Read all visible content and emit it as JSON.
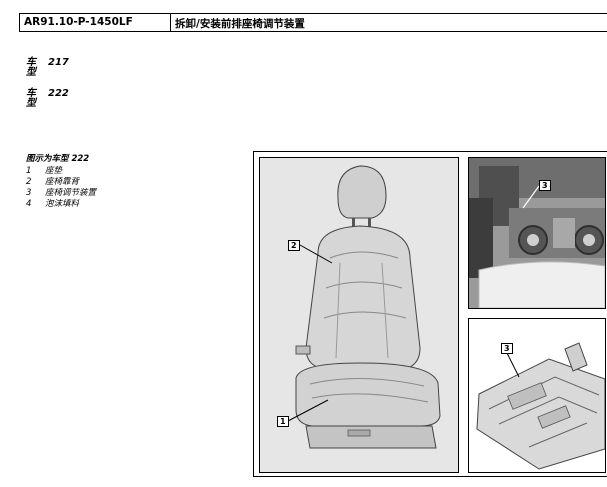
{
  "header": {
    "code": "AR91.10-P-1450LF",
    "title": "拆卸/安装前排座椅调节装置"
  },
  "models": [
    {
      "label": "车型",
      "value": "217"
    },
    {
      "label": "车型",
      "value": "222"
    }
  ],
  "legend": {
    "heading": "图示为车型 222",
    "items": [
      {
        "num": "1",
        "text": "座垫"
      },
      {
        "num": "2",
        "text": "座椅靠背"
      },
      {
        "num": "3",
        "text": "座椅调节装置"
      },
      {
        "num": "4",
        "text": "泡沫填料"
      }
    ]
  },
  "figure": {
    "callouts": {
      "seat_backrest": "2",
      "seat_cushion": "1",
      "top_right_adjuster": "3",
      "bottom_right_adjuster": "3"
    }
  }
}
